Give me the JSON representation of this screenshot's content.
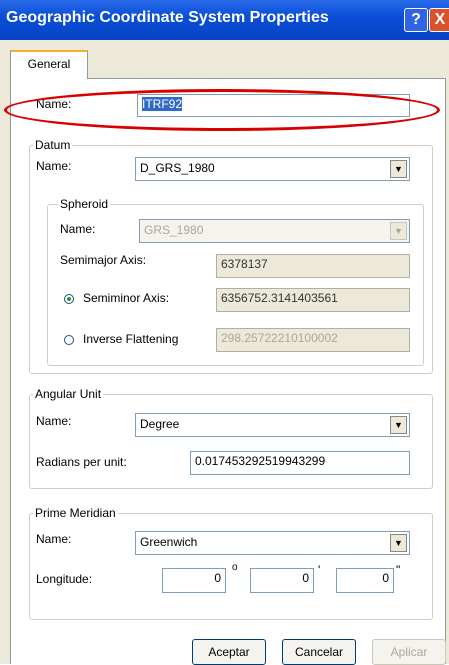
{
  "window": {
    "title": "Geographic Coordinate System Properties",
    "help_glyph": "?",
    "close_glyph": "X"
  },
  "tabs": [
    {
      "label": "General"
    }
  ],
  "name": {
    "label": "Name:",
    "value": "ITRF92"
  },
  "datum": {
    "legend": "Datum",
    "name_label": "Name:",
    "name_value": "D_GRS_1980",
    "spheroid": {
      "legend": "Spheroid",
      "name_label": "Name:",
      "name_value": "GRS_1980",
      "semimajor_label": "Semimajor Axis:",
      "semimajor_value": "6378137",
      "semiminor_label": "Semiminor Axis:",
      "semiminor_value": "6356752.3141403561",
      "inverse_label": "Inverse Flattening",
      "inverse_value": "298.25722210100002",
      "selected": "semiminor"
    }
  },
  "angular_unit": {
    "legend": "Angular Unit",
    "name_label": "Name:",
    "name_value": "Degree",
    "radians_label": "Radians per unit:",
    "radians_value": "0.017453292519943299"
  },
  "prime_meridian": {
    "legend": "Prime Meridian",
    "name_label": "Name:",
    "name_value": "Greenwich",
    "longitude_label": "Longitude:",
    "deg": "0",
    "min": "0",
    "sec": "0",
    "deg_symbol": "o",
    "min_symbol": "'",
    "sec_symbol": "\""
  },
  "buttons": {
    "ok": "Aceptar",
    "cancel": "Cancelar",
    "apply": "Aplicar"
  },
  "icons": {
    "dropdown": "chevron-down-icon"
  },
  "colors": {
    "titlebar": "#0a4fd8",
    "highlight": "#d90000",
    "dialog": "#ece9d8"
  }
}
